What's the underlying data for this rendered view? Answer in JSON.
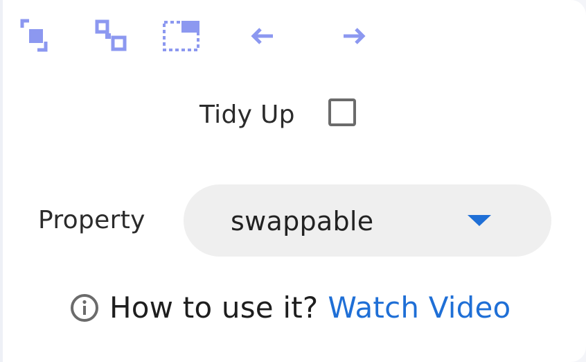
{
  "toolbar": {
    "icons": [
      {
        "name": "bring-to-front-icon"
      },
      {
        "name": "send-to-back-icon"
      },
      {
        "name": "select-area-icon"
      },
      {
        "name": "arrow-left-icon"
      },
      {
        "name": "arrow-right-icon"
      }
    ],
    "icon_color": "#8c98f0"
  },
  "tidy": {
    "label": "Tidy Up",
    "checked": false
  },
  "property": {
    "label": "Property",
    "selected": "swappable"
  },
  "help": {
    "question": "How to use it?",
    "link_text": "Watch Video",
    "link_color": "#1f6fd6"
  }
}
